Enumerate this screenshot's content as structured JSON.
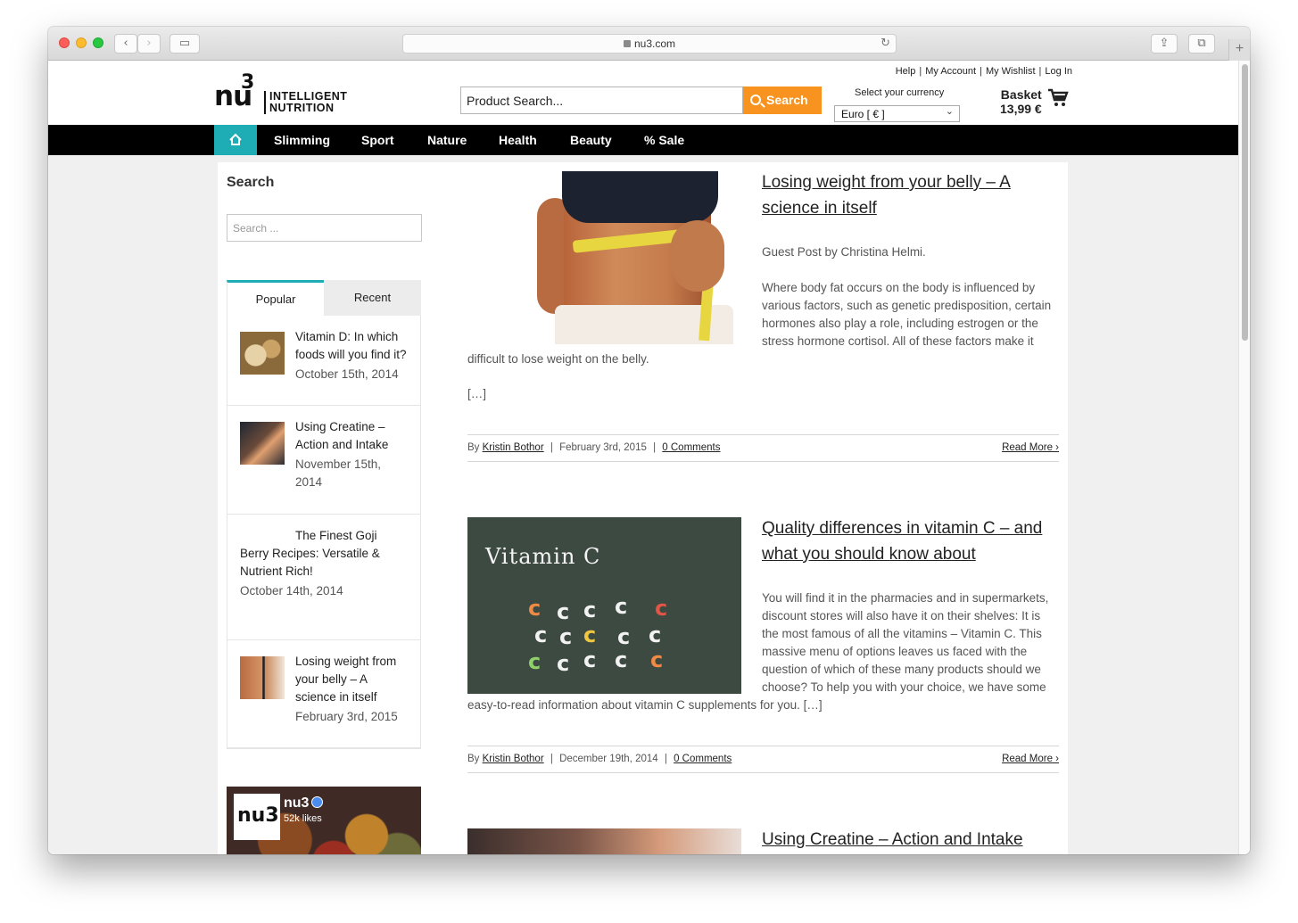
{
  "browser": {
    "url": "nu3.com"
  },
  "header": {
    "top_links": [
      "Help",
      "My Account",
      "My Wishlist",
      "Log In"
    ],
    "logo_mark": "nu",
    "logo_super": "3",
    "logo_line1": "INTELLIGENT",
    "logo_line2": "NUTRITION",
    "product_search_value": "Product Search...",
    "search_button": "Search",
    "currency_label": "Select your currency",
    "currency_value": "Euro [ € ]",
    "basket_label": "Basket",
    "basket_total": "13,99 €"
  },
  "nav": {
    "items": [
      "Slimming",
      "Sport",
      "Nature",
      "Health",
      "Beauty",
      "% Sale"
    ]
  },
  "sidebar": {
    "title": "Search",
    "search_placeholder": "Search ...",
    "tabs": [
      "Popular",
      "Recent"
    ],
    "popular": [
      {
        "title": "Vitamin D: In which foods will you find it?",
        "date": "October 15th, 2014"
      },
      {
        "title": "Using Creatine – Action and Intake",
        "date": "November 15th, 2014"
      },
      {
        "title": "The Finest Goji Berry Recipes: Versatile & Nutrient Rich!",
        "date": "October 14th, 2014"
      },
      {
        "title": "Losing weight from your belly – A science in itself",
        "date": "February 3rd, 2015"
      }
    ],
    "facebook": {
      "name": "nu3",
      "likes": "52k likes",
      "logo_text": "nu3"
    }
  },
  "posts": [
    {
      "title": "Losing weight from your belly – A science in itself",
      "intro": "Guest Post by Christina Helmi.",
      "body": "Where body fat occurs on the body is influenced by various factors, such as genetic predisposition, certain hormones also play a role, including estrogen or the stress hormone cortisol. All of these factors make it",
      "body_cont": "difficult to lose weight on the belly.",
      "ellipsis": "[…]",
      "by": "By",
      "author": "Kristin Bothor",
      "date": "February 3rd, 2015",
      "comments": "0 Comments",
      "read_more": "Read More"
    },
    {
      "title": "Quality differences in vitamin C – and what you should know about",
      "image_text": "Vitamin C",
      "body": "You will find it in the pharmacies and in supermarkets, discount stores will also have it on their shelves: It is the most famous of all the vitamins – Vitamin C. This massive menu of options leaves us faced with the question of which of these many products should we choose? To help you with your choice, we have some",
      "body_cont": "easy-to-read information about vitamin C supplements for you. […]",
      "by": "By",
      "author": "Kristin Bothor",
      "date": "December 19th, 2014",
      "comments": "0 Comments",
      "read_more": "Read More"
    },
    {
      "title": "Using Creatine – Action and Intake"
    }
  ],
  "colors": {
    "accent_teal": "#1eadb4",
    "search_orange": "#f7931e",
    "nav_black": "#000000"
  }
}
